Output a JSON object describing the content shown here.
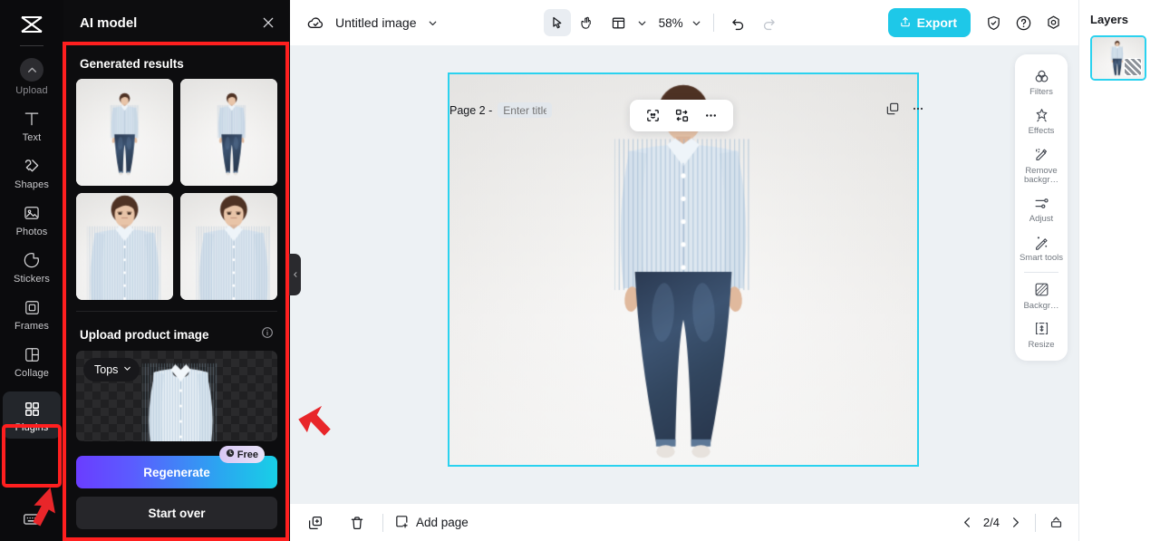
{
  "app": {
    "brand_icon": "capcut-logo-icon",
    "accent_cyan": "#1ec8e8",
    "annotation_red": "#ff1f1f",
    "canvas_bg": "#edf1f4"
  },
  "left_rail": {
    "items": [
      {
        "label": "Upload",
        "icon": "upload-chevron-icon",
        "active": false
      },
      {
        "label": "Text",
        "icon": "text-icon",
        "active": false
      },
      {
        "label": "Shapes",
        "icon": "shapes-icon",
        "active": false
      },
      {
        "label": "Photos",
        "icon": "photos-icon",
        "active": false
      },
      {
        "label": "Stickers",
        "icon": "stickers-icon",
        "active": false
      },
      {
        "label": "Frames",
        "icon": "frames-icon",
        "active": false
      },
      {
        "label": "Collage",
        "icon": "collage-icon",
        "active": false
      },
      {
        "label": "Plugins",
        "icon": "plugins-grid-icon",
        "active": true
      }
    ],
    "bottom_icon": "keyboard-shortcuts-icon"
  },
  "panel": {
    "title": "AI model",
    "close_icon": "close-icon",
    "generated": {
      "heading": "Generated results",
      "thumbnails": [
        {
          "alt": "model-full-body-front"
        },
        {
          "alt": "model-full-body-front-alt"
        },
        {
          "alt": "model-upper-body-front"
        },
        {
          "alt": "model-upper-body-angled"
        }
      ]
    },
    "upload": {
      "heading": "Upload product image",
      "info_icon": "info-icon",
      "category_chip": "Tops",
      "chip_chevron": "chevron-down-icon",
      "product_alt": "striped-shirt-cutout"
    },
    "regenerate_label": "Regenerate",
    "free_badge": "Free",
    "free_badge_icon": "coin-icon",
    "start_over_label": "Start over",
    "collapse_icon": "chevron-left-icon"
  },
  "topbar": {
    "cloud_icon": "cloud-saved-icon",
    "doc_title": "Untitled image",
    "title_chevron": "chevron-down-icon",
    "tools": [
      {
        "name": "select-tool",
        "icon": "cursor-arrow-icon",
        "selected": true
      },
      {
        "name": "hand-tool",
        "icon": "hand-icon",
        "selected": false
      },
      {
        "name": "layout-tool",
        "icon": "layout-icon",
        "selected": false
      }
    ],
    "layout_chevron": "chevron-down-icon",
    "zoom_level": "58%",
    "zoom_chevron": "chevron-down-icon",
    "undo_icon": "undo-icon",
    "redo_icon": "redo-icon",
    "export_label": "Export",
    "export_icon": "share-up-icon",
    "shield_icon": "shield-check-icon",
    "help_icon": "help-circle-icon",
    "settings_icon": "settings-gear-icon"
  },
  "canvas": {
    "page_label": "Page 2 -",
    "page_title_placeholder": "Enter title",
    "float_tools": [
      {
        "name": "cutout-tool",
        "icon": "dashed-select-icon"
      },
      {
        "name": "ai-replace-tool",
        "icon": "swap-shapes-icon"
      },
      {
        "name": "more-tool",
        "icon": "ellipsis-icon"
      }
    ],
    "page_actions": [
      {
        "name": "duplicate-page",
        "icon": "duplicate-icon"
      },
      {
        "name": "page-more",
        "icon": "ellipsis-icon"
      }
    ],
    "artwork_alt": "male-model-striped-shirt-jeans"
  },
  "right_tools": {
    "groups": [
      [
        {
          "label": "Filters",
          "icon": "filters-icon"
        },
        {
          "label": "Effects",
          "icon": "effects-sparkle-icon"
        },
        {
          "label": "Remove backgr…",
          "icon": "remove-background-icon"
        },
        {
          "label": "Adjust",
          "icon": "adjust-sliders-icon"
        },
        {
          "label": "Smart tools",
          "icon": "magic-wand-icon"
        }
      ],
      [
        {
          "label": "Backgr…",
          "icon": "background-icon"
        },
        {
          "label": "Resize",
          "icon": "resize-icon"
        }
      ]
    ]
  },
  "bottombar": {
    "duplicate_icon": "duplicate-page-icon",
    "delete_icon": "trash-icon",
    "add_page_label": "Add page",
    "add_page_icon": "add-page-icon",
    "prev_icon": "chevron-left-icon",
    "page_indicator": "2/4",
    "next_icon": "chevron-right-icon",
    "pages_panel_icon": "pages-tray-icon"
  },
  "layers": {
    "title": "Layers",
    "items": [
      {
        "alt": "layer-model-image",
        "selected": true,
        "badge_icon": "transparency-badge-icon"
      }
    ]
  }
}
